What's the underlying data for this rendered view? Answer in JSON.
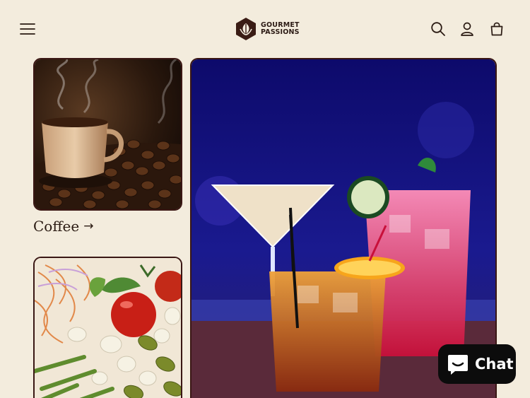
{
  "header": {
    "logo_line1": "GOURMET",
    "logo_line2": "PASSIONS",
    "icons": [
      "menu-icon",
      "search-icon",
      "account-icon",
      "cart-icon"
    ]
  },
  "collections": [
    {
      "label": "Coffee",
      "arrow": "→",
      "image": "coffee cup with coffee beans"
    },
    {
      "image": "cocktails"
    },
    {
      "image": "salad with tomato and olives"
    }
  ],
  "chat_widget": {
    "label": "Chat",
    "icon": "chat-bubble-icon"
  },
  "colors": {
    "background": "#f3ecdd",
    "card_border": "#3a1714",
    "text": "#2a1a12",
    "chat_bg": "#0c0c0c"
  }
}
